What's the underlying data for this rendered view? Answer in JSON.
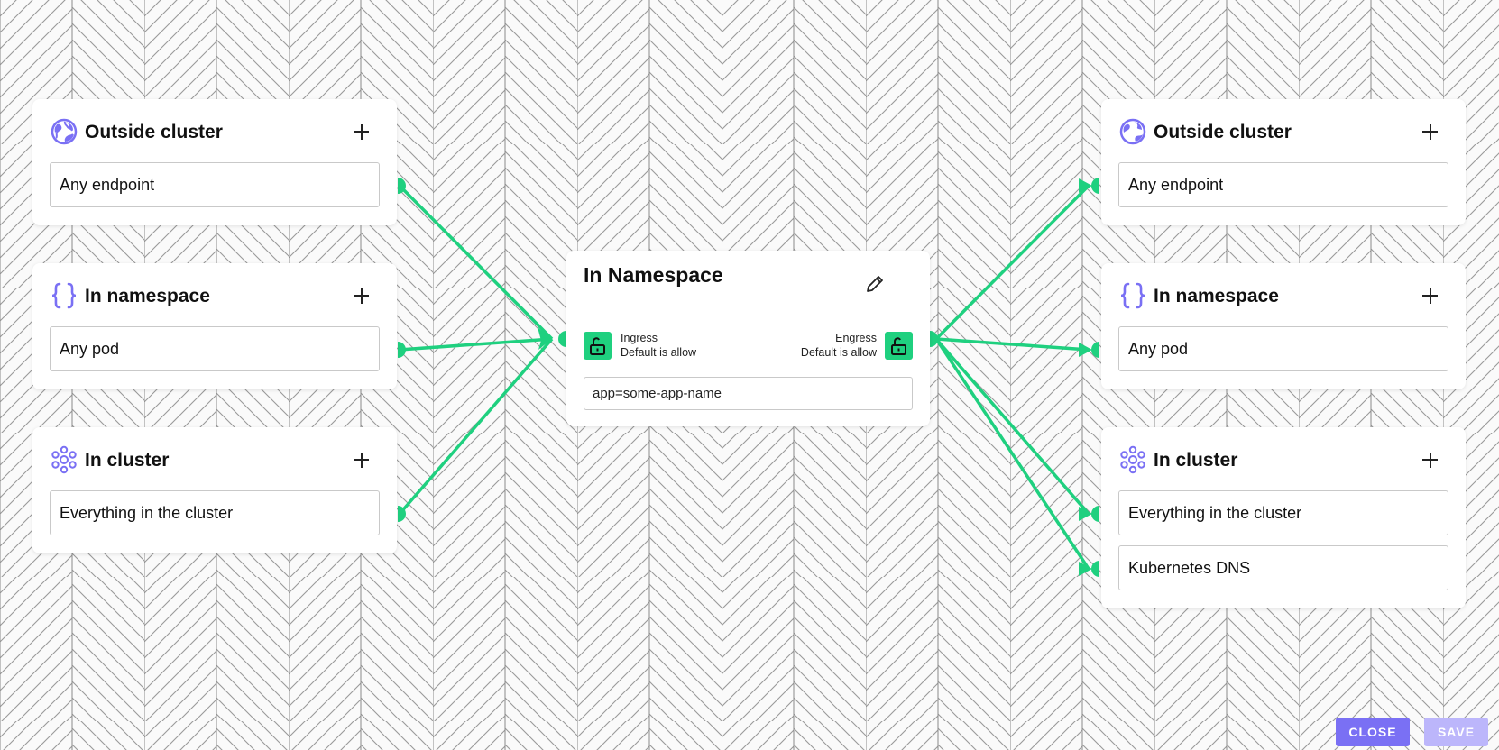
{
  "colors": {
    "edge": "#1fd07f",
    "icon": "#7a70f4",
    "button_primary": "#7a70f4",
    "button_disabled": "#bcb6fb"
  },
  "ingress": {
    "outside": {
      "title": "Outside cluster",
      "icon": "globe-icon",
      "items": [
        "Any endpoint"
      ]
    },
    "namespace": {
      "title": "In namespace",
      "icon": "braces-icon",
      "items": [
        "Any pod"
      ]
    },
    "cluster": {
      "title": "In cluster",
      "icon": "cluster-icon",
      "items": [
        "Everything in the cluster"
      ]
    }
  },
  "center": {
    "title": "In Namespace",
    "ingress_label": "Ingress",
    "ingress_status": "Default is allow",
    "egress_label": "Engress",
    "egress_status": "Default is allow",
    "selector": "app=some-app-name"
  },
  "egress": {
    "outside": {
      "title": "Outside cluster",
      "icon": "globe-icon",
      "items": [
        "Any endpoint"
      ]
    },
    "namespace": {
      "title": "In namespace",
      "icon": "braces-icon",
      "items": [
        "Any pod"
      ]
    },
    "cluster": {
      "title": "In cluster",
      "icon": "cluster-icon",
      "items": [
        "Everything in the cluster",
        "Kubernetes DNS"
      ]
    }
  },
  "footer": {
    "close_label": "CLOSE",
    "save_label": "SAVE"
  }
}
